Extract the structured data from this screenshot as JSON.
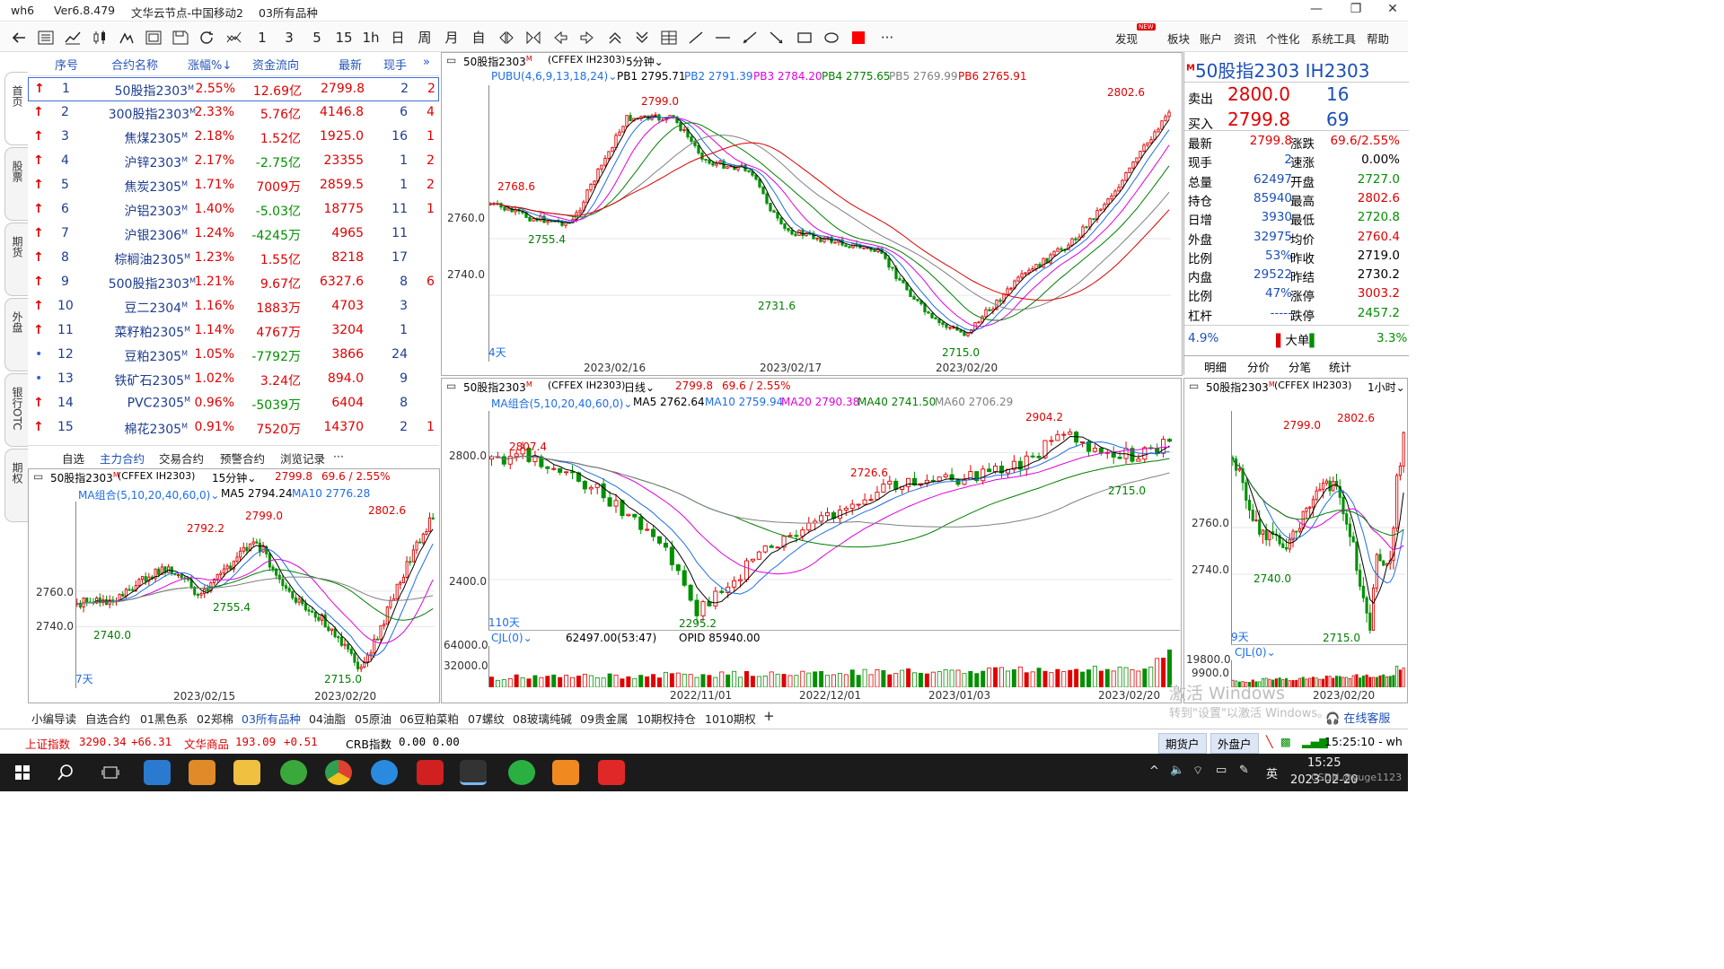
{
  "window": {
    "app": "wh6",
    "version": "Ver6.8.479",
    "node": "文华云节点-中国移动2",
    "page": "03所有品种",
    "controls": {
      "minimize": "—",
      "restore": "❐",
      "close": "✕"
    }
  },
  "toolbar": {
    "tools": [
      "back-icon",
      "list-icon",
      "line-chart-icon",
      "kline-icon",
      "signal-icon",
      "f10-icon",
      "save-icon",
      "refresh-icon",
      "indicator-icon"
    ],
    "periods": [
      "1",
      "3",
      "5",
      "15",
      "1h",
      "日",
      "周",
      "月",
      "自"
    ],
    "draw_tools": [
      "zoom-in-icon",
      "zoom-out-icon",
      "left-icon",
      "right-icon",
      "up-icon",
      "down-icon",
      "layout-icon",
      "draw-line-icon",
      "hline-icon",
      "ray-icon",
      "segment-icon",
      "rect-icon",
      "ellipse-icon",
      "color-icon",
      "more-icon"
    ],
    "menu": [
      "发现",
      "板块",
      "账户",
      "资讯",
      "个性化",
      "系统工具",
      "帮助"
    ],
    "badge": "NEW"
  },
  "left_tabs": [
    "首页",
    "股票",
    "期货",
    "外盘",
    "银行OTC",
    "期权"
  ],
  "quote_list": {
    "headers": [
      "序号",
      "合约名称",
      "涨幅%↓",
      "资金流向",
      "最新",
      "现手"
    ],
    "more": "»",
    "rows": [
      {
        "no": "1",
        "name": "50股指2303",
        "m": "M",
        "chg": "2.55%",
        "flow": "12.69亿",
        "last": "2799.8",
        "vol": "2",
        "x": "2",
        "mark": "up",
        "flow_up": true
      },
      {
        "no": "2",
        "name": "300股指2303",
        "m": "M",
        "chg": "2.33%",
        "flow": "5.76亿",
        "last": "4146.8",
        "vol": "6",
        "x": "4",
        "mark": "up",
        "flow_up": true
      },
      {
        "no": "3",
        "name": "焦煤2305",
        "m": "M",
        "chg": "2.18%",
        "flow": "1.52亿",
        "last": "1925.0",
        "vol": "16",
        "x": "1",
        "mark": "up",
        "flow_up": true
      },
      {
        "no": "4",
        "name": "沪锌2303",
        "m": "M",
        "chg": "2.17%",
        "flow": "-2.75亿",
        "last": "23355",
        "vol": "1",
        "x": "2",
        "mark": "up",
        "flow_up": false
      },
      {
        "no": "5",
        "name": "焦炭2305",
        "m": "M",
        "chg": "1.71%",
        "flow": "7009万",
        "last": "2859.5",
        "vol": "1",
        "x": "2",
        "mark": "up",
        "flow_up": true
      },
      {
        "no": "6",
        "name": "沪铝2303",
        "m": "M",
        "chg": "1.40%",
        "flow": "-5.03亿",
        "last": "18775",
        "vol": "11",
        "x": "1",
        "mark": "up",
        "flow_up": false
      },
      {
        "no": "7",
        "name": "沪银2306",
        "m": "M",
        "chg": "1.24%",
        "flow": "-4245万",
        "last": "4965",
        "vol": "11",
        "x": "",
        "mark": "up",
        "flow_up": false
      },
      {
        "no": "8",
        "name": "棕榈油2305",
        "m": "M",
        "chg": "1.23%",
        "flow": "1.55亿",
        "last": "8218",
        "vol": "17",
        "x": "",
        "mark": "up",
        "flow_up": true
      },
      {
        "no": "9",
        "name": "500股指2303",
        "m": "M",
        "chg": "1.21%",
        "flow": "9.67亿",
        "last": "6327.6",
        "vol": "8",
        "x": "6",
        "mark": "up",
        "flow_up": true
      },
      {
        "no": "10",
        "name": "豆二2304",
        "m": "M",
        "chg": "1.16%",
        "flow": "1883万",
        "last": "4703",
        "vol": "3",
        "x": "",
        "mark": "up",
        "flow_up": true
      },
      {
        "no": "11",
        "name": "菜籽粕2305",
        "m": "M",
        "chg": "1.14%",
        "flow": "4767万",
        "last": "3204",
        "vol": "1",
        "x": "",
        "mark": "up",
        "flow_up": true
      },
      {
        "no": "12",
        "name": "豆粕2305",
        "m": "M",
        "chg": "1.05%",
        "flow": "-7792万",
        "last": "3866",
        "vol": "24",
        "x": "",
        "mark": "dot",
        "flow_up": false
      },
      {
        "no": "13",
        "name": "铁矿石2305",
        "m": "M",
        "chg": "1.02%",
        "flow": "3.24亿",
        "last": "894.0",
        "vol": "9",
        "x": "",
        "mark": "dot",
        "flow_up": true
      },
      {
        "no": "14",
        "name": "PVC2305",
        "m": "M",
        "chg": "0.96%",
        "flow": "-5039万",
        "last": "6404",
        "vol": "8",
        "x": "",
        "mark": "up",
        "flow_up": false
      },
      {
        "no": "15",
        "name": "棉花2305",
        "m": "M",
        "chg": "0.91%",
        "flow": "7520万",
        "last": "14370",
        "vol": "2",
        "x": "1",
        "mark": "up",
        "flow_up": true
      }
    ],
    "tabs": [
      "自选",
      "主力合约",
      "交易合约",
      "预警合约",
      "浏览记录",
      "···"
    ]
  },
  "chart_5min": {
    "title": "50股指2303",
    "m": "M",
    "code": "(CFFEX IH2303)",
    "period": "5分钟",
    "ind_name": "PUBU(4,6,9,13,18,24)",
    "pb": [
      "PB1 2795.71",
      "PB2 2791.39",
      "PB3 2784.20",
      "PB4 2775.65",
      "PB5 2769.99",
      "PB6 2765.91"
    ],
    "y_ticks": [
      "2760.0",
      "2740.0"
    ],
    "x_ticks": [
      "2023/02/16",
      "2023/02/17",
      "2023/02/20"
    ],
    "labels": [
      "2799.0",
      "2768.6",
      "2755.4",
      "2731.6",
      "2715.0",
      "2802.6"
    ],
    "days": "4天"
  },
  "chart_daily": {
    "title": "50股指2303",
    "m": "M",
    "code": "(CFFEX IH2303)",
    "period": "日线",
    "last": "2799.8",
    "change": "69.6 / 2.55%",
    "ind_name": "MA组合(5,10,20,40,60,0)",
    "ma": [
      "MA5 2762.64",
      "MA10 2759.94",
      "MA20 2790.38",
      "MA40 2741.50",
      "MA60 2706.29"
    ],
    "y_ticks": [
      "2800.0",
      "2400.0"
    ],
    "labels": [
      "2807.4",
      "2295.2",
      "2726.6",
      "2904.2",
      "2715.0"
    ],
    "days": "110天",
    "vol_name": "CJL(0)",
    "vol_vals": "62497.00(53:47)",
    "opid": "OPID 85940.00",
    "vol_ticks": [
      "64000.0",
      "32000.0"
    ],
    "x_ticks": [
      "2022/11/01",
      "2022/12/01",
      "2023/01/03",
      "2023/02/20"
    ]
  },
  "chart_15min": {
    "title": "50股指2303",
    "m": "M",
    "code": "(CFFEX IH2303)",
    "period": "15分钟",
    "last": "2799.8",
    "change": "69.6 / 2.55%",
    "ind_name": "MA组合(5,10,20,40,60,0)",
    "ma": [
      "MA5 2794.24",
      "MA10 2776.28"
    ],
    "y_ticks": [
      "2760.0",
      "2740.0"
    ],
    "labels": [
      "2792.2",
      "2799.0",
      "2802.6",
      "2740.0",
      "2755.4",
      "2715.0"
    ],
    "days": "7天",
    "x_ticks": [
      "2023/02/15",
      "2023/02/20"
    ]
  },
  "chart_1h": {
    "title": "50股指2303",
    "m": "M",
    "code": "(CFFEX IH2303)",
    "period": "1小时",
    "y_ticks": [
      "2760.0",
      "2740.0"
    ],
    "labels": [
      "2799.0",
      "2802.6",
      "2740.0",
      "2715.0"
    ],
    "days": "9天",
    "vol_name": "CJL(0)",
    "vol_ticks": [
      "19800.0",
      "9900.0"
    ],
    "x_ticks": [
      "2023/02/20"
    ]
  },
  "info": {
    "title": "50股指2303  IH2303",
    "m": "M",
    "ask_label": "卖出",
    "ask": "2800.0",
    "ask_vol": "16",
    "bid_label": "买入",
    "bid": "2799.8",
    "bid_vol": "69",
    "rows": [
      {
        "l1": "最新",
        "v1": "2799.8",
        "c1": "red",
        "l2": "涨跌",
        "v2": "69.6/2.55%",
        "c2": "red"
      },
      {
        "l1": "现手",
        "v1": "2",
        "c1": "blu",
        "l2": "速涨",
        "v2": "0.00%",
        "c2": "blk"
      },
      {
        "l1": "总量",
        "v1": "62497",
        "c1": "blu",
        "l2": "开盘",
        "v2": "2727.0",
        "c2": "grn"
      },
      {
        "l1": "持仓",
        "v1": "85940",
        "c1": "blu",
        "l2": "最高",
        "v2": "2802.6",
        "c2": "red"
      },
      {
        "l1": "日增",
        "v1": "3930",
        "c1": "blu",
        "l2": "最低",
        "v2": "2720.8",
        "c2": "grn"
      },
      {
        "l1": "外盘",
        "v1": "32975",
        "c1": "blu",
        "l2": "均价",
        "v2": "2760.4",
        "c2": "red"
      },
      {
        "l1": "比例",
        "v1": "53%",
        "c1": "blu",
        "l2": "昨收",
        "v2": "2719.0",
        "c2": "blk"
      },
      {
        "l1": "内盘",
        "v1": "29522",
        "c1": "blu",
        "l2": "昨结",
        "v2": "2730.2",
        "c2": "blk"
      },
      {
        "l1": "比例",
        "v1": "47%",
        "c1": "blu",
        "l2": "涨停",
        "v2": "3003.2",
        "c2": "red"
      },
      {
        "l1": "杠杆",
        "v1": "-----",
        "c1": "blu",
        "l2": "跌停",
        "v2": "2457.2",
        "c2": "grn"
      }
    ],
    "buy_pct": "4.9%",
    "big_label": "大单",
    "sell_pct": "3.3%",
    "tabs": [
      "明细",
      "分价",
      "分笔",
      "统计"
    ]
  },
  "workspace_tabs": [
    "小编导读",
    "自选合约",
    "01黑色系",
    "02郑棉",
    "03所有品种",
    "04油脂",
    "05原油",
    "06豆粕菜粕",
    "07螺纹",
    "08玻璃纯碱",
    "09贵金属",
    "10期权持仓",
    "1010期权",
    "+"
  ],
  "status": {
    "sh_label": "上证指数",
    "sh_val": "3290.34",
    "sh_chg": "+66.31",
    "wh_label": "文华商品",
    "wh_val": "193.09",
    "wh_chg": "+0.51",
    "crb_label": "CRB指数",
    "crb_val": "0.00  0.00",
    "btn1": "期货户",
    "btn2": "外盘户",
    "time": "15:25:10 - wh",
    "online": "在线客服"
  },
  "taskbar": {
    "time": "15:25",
    "date": "2023-02-20",
    "ime": "英",
    "apps": [
      "start-icon",
      "search-icon",
      "taskview-icon",
      "news-app-icon",
      "paint-app-icon",
      "explorer-app-icon",
      "ie-app-icon",
      "chrome-app-icon",
      "k-app-icon",
      "chart-app-icon",
      "wh6-app-icon",
      "wechat-app-icon",
      "video-app-icon",
      "wps-app-icon"
    ]
  },
  "watermark": {
    "l1": "激活 Windows",
    "l2": "转到\"设置\"以激活 Windows。",
    "csdn": "CSDN @yuge1123"
  },
  "colors": {
    "up": "#e00000",
    "down": "#009000",
    "blue": "#1b4fb8",
    "ma5": "#000000",
    "ma10": "#1e6ee8",
    "ma20": "#e000e0",
    "ma40": "#008000",
    "ma60": "#808080"
  }
}
